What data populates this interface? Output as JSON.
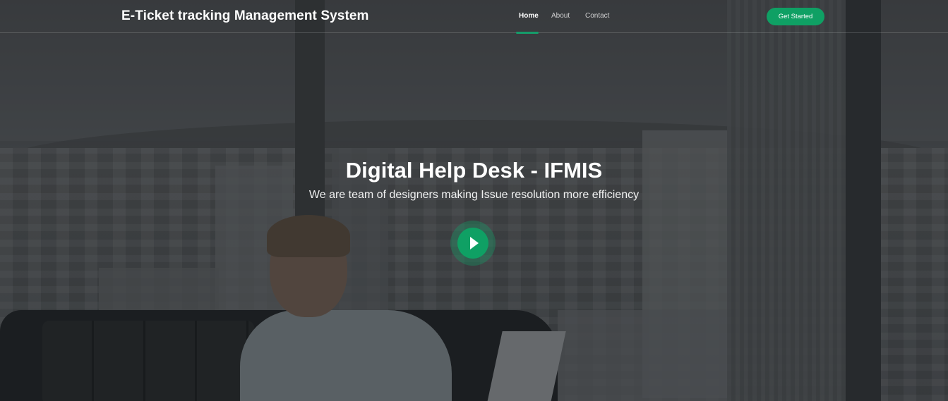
{
  "header": {
    "brand": "E-Ticket tracking Management System",
    "nav": [
      {
        "label": "Home",
        "active": true
      },
      {
        "label": "About",
        "active": false
      },
      {
        "label": "Contact",
        "active": false
      }
    ],
    "cta_label": "Get Started"
  },
  "hero": {
    "title": "Digital Help Desk - IFMIS",
    "subtitle": "We are team of designers making Issue resolution more efficiency",
    "play_icon": "play-icon",
    "background_icon": "office-city-view-image"
  },
  "colors": {
    "accent": "#0fa064",
    "text": "#ffffff"
  }
}
